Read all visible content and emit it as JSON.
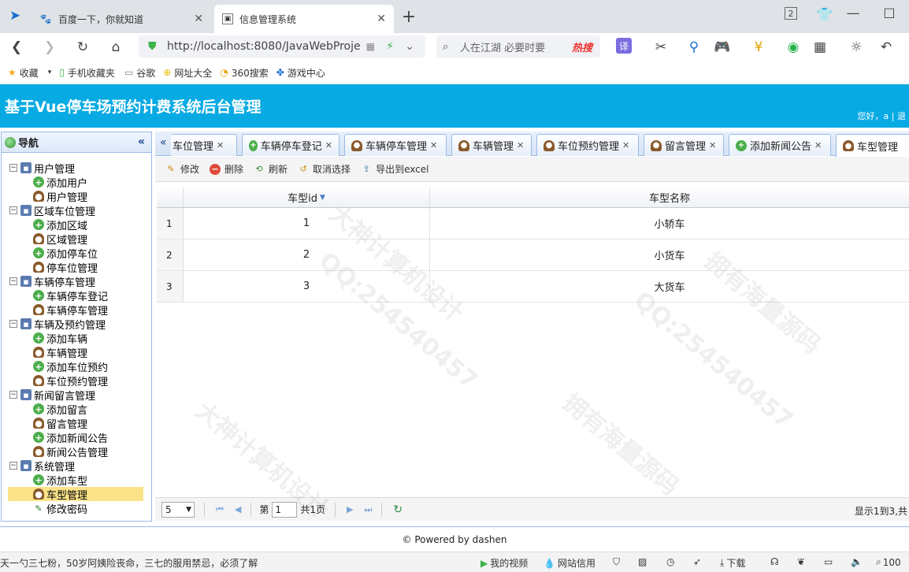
{
  "browser": {
    "tabs": [
      {
        "title": "百度一下，你就知道",
        "icon": "baidu-paw-icon"
      },
      {
        "title": "信息管理系统",
        "icon": "page-icon"
      }
    ],
    "tab_count": "2",
    "address": "http://localhost:8080/JavaWebProje",
    "search_text": "人在江湖 必要时要",
    "hot_label": "热搜",
    "bookmarks": [
      "收藏",
      "手机收藏夹",
      "谷歌",
      "网址大全",
      "360搜索",
      "游戏中心"
    ]
  },
  "app": {
    "title": "基于Vue停车场预约计费系统后台管理",
    "greeting": "您好，a | 退"
  },
  "nav": {
    "title": "导航",
    "groups": [
      {
        "label": "用户管理",
        "items": [
          {
            "label": "添加用户",
            "icon": "add"
          },
          {
            "label": "用户管理",
            "icon": "user"
          }
        ]
      },
      {
        "label": "区域车位管理",
        "items": [
          {
            "label": "添加区域",
            "icon": "add"
          },
          {
            "label": "区域管理",
            "icon": "user"
          },
          {
            "label": "添加停车位",
            "icon": "add"
          },
          {
            "label": "停车位管理",
            "icon": "user"
          }
        ]
      },
      {
        "label": "车辆停车管理",
        "items": [
          {
            "label": "车辆停车登记",
            "icon": "add"
          },
          {
            "label": "车辆停车管理",
            "icon": "user"
          }
        ]
      },
      {
        "label": "车辆及预约管理",
        "items": [
          {
            "label": "添加车辆",
            "icon": "add"
          },
          {
            "label": "车辆管理",
            "icon": "user"
          },
          {
            "label": "添加车位预约",
            "icon": "add"
          },
          {
            "label": "车位预约管理",
            "icon": "user"
          }
        ]
      },
      {
        "label": "新闻留言管理",
        "items": [
          {
            "label": "添加留言",
            "icon": "add"
          },
          {
            "label": "留言管理",
            "icon": "user"
          },
          {
            "label": "添加新闻公告",
            "icon": "add"
          },
          {
            "label": "新闻公告管理",
            "icon": "user"
          }
        ]
      },
      {
        "label": "系统管理",
        "items": [
          {
            "label": "添加车型",
            "icon": "add"
          },
          {
            "label": "车型管理",
            "icon": "user",
            "selected": true
          },
          {
            "label": "修改密码",
            "icon": "pen"
          }
        ]
      }
    ]
  },
  "content_tabs": [
    {
      "label": "车位管理",
      "icon": "none"
    },
    {
      "label": "车辆停车登记",
      "icon": "add"
    },
    {
      "label": "车辆停车管理",
      "icon": "user"
    },
    {
      "label": "车辆管理",
      "icon": "user"
    },
    {
      "label": "车位预约管理",
      "icon": "user"
    },
    {
      "label": "留言管理",
      "icon": "user"
    },
    {
      "label": "添加新闻公告",
      "icon": "add"
    },
    {
      "label": "车型管理",
      "icon": "user",
      "active": true
    }
  ],
  "grid_toolbar": {
    "edit": "修改",
    "delete": "删除",
    "refresh": "刷新",
    "clear": "取消选择",
    "export": "导出到excel"
  },
  "grid": {
    "columns": [
      "车型id",
      "车型名称"
    ],
    "rows": [
      {
        "num": "1",
        "id": "1",
        "name": "小轿车"
      },
      {
        "num": "2",
        "id": "2",
        "name": "小货车"
      },
      {
        "num": "3",
        "id": "3",
        "name": "大货车"
      }
    ]
  },
  "pager": {
    "page_size": "5",
    "page_label": "第",
    "page_value": "1",
    "total_pages": "共1页",
    "info": "显示1到3,共"
  },
  "footer": "© Powered by dashen",
  "statusbar": {
    "news": "天一勺三七粉，50岁阿姨险丧命，三七的服用禁忌，必须了解",
    "items": [
      "我的视频",
      "网站信用",
      "下载",
      "100"
    ]
  },
  "watermarks": [
    "QQ:254540457",
    "大神计算机设计",
    "拥有海量源码"
  ]
}
